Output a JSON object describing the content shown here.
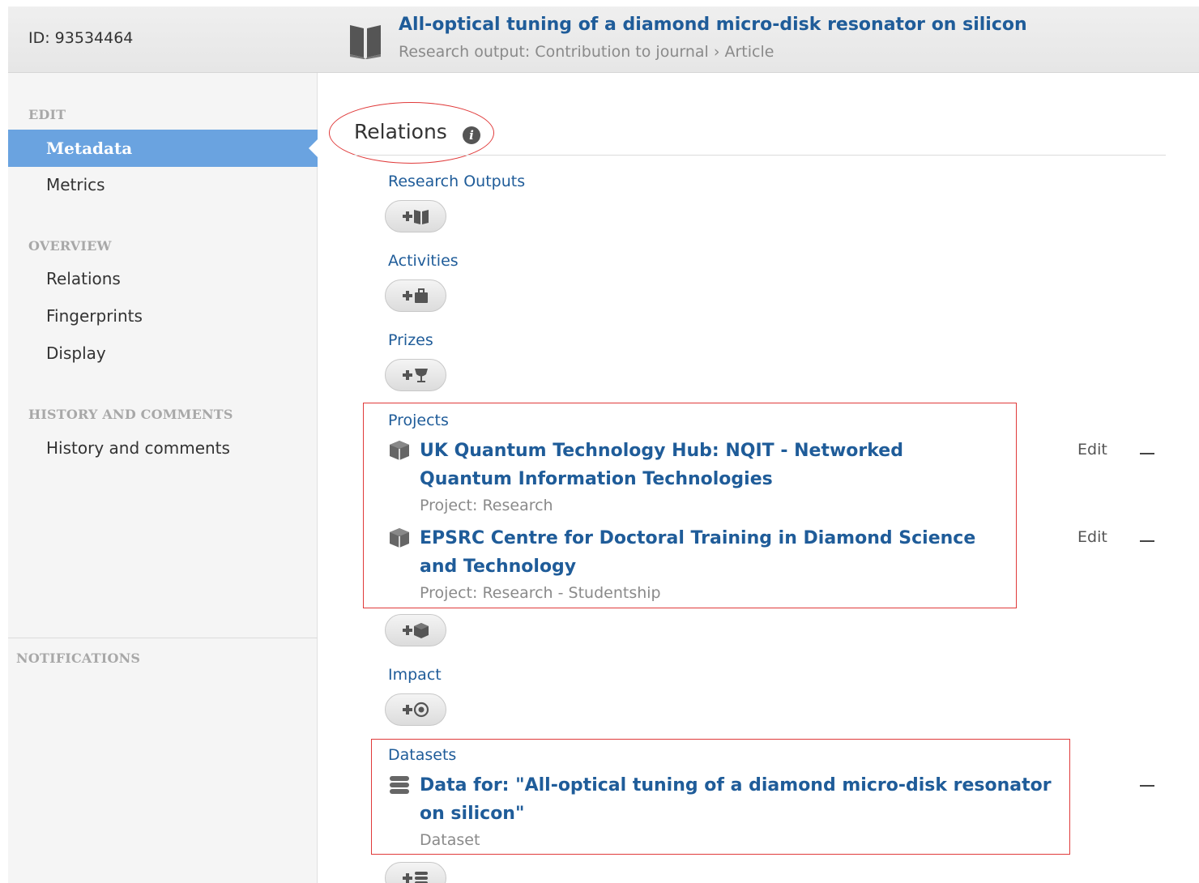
{
  "header": {
    "id_label": "ID: 93534464",
    "title": "All-optical tuning of a diamond micro-disk resonator on silicon",
    "subtitle": "Research output: Contribution to journal › Article",
    "icon": "book-icon"
  },
  "sidebar": {
    "sections": {
      "edit": "EDIT",
      "overview": "OVERVIEW",
      "history": "HISTORY AND COMMENTS",
      "notifications": "NOTIFICATIONS"
    },
    "items": {
      "metadata": "Metadata",
      "metrics": "Metrics",
      "relations": "Relations",
      "fingerprints": "Fingerprints",
      "display": "Display",
      "history_comments": "History and comments"
    },
    "active_item": "Metadata"
  },
  "main": {
    "heading": "Relations",
    "info_icon": "i",
    "sections": {
      "research_outputs": {
        "label": "Research Outputs",
        "add_icon": "add-research-output-icon"
      },
      "activities": {
        "label": "Activities",
        "add_icon": "add-activity-icon"
      },
      "prizes": {
        "label": "Prizes",
        "add_icon": "add-prize-icon"
      },
      "projects": {
        "label": "Projects",
        "add_icon": "add-project-icon",
        "items": [
          {
            "title": "UK Quantum Technology Hub: NQIT - Networked Quantum Information Technologies",
            "subtitle": "Project: Research",
            "edit": "Edit"
          },
          {
            "title": "EPSRC Centre for Doctoral Training in Diamond Science and Technology",
            "subtitle": "Project: Research - Studentship",
            "edit": "Edit"
          }
        ]
      },
      "impact": {
        "label": "Impact",
        "add_icon": "add-impact-icon"
      },
      "datasets": {
        "label": "Datasets",
        "add_icon": "add-dataset-icon",
        "items": [
          {
            "title": "Data for: \"All-optical tuning of a diamond micro-disk resonator on silicon\"",
            "subtitle": "Dataset"
          }
        ]
      }
    }
  },
  "colors": {
    "link_blue": "#1f5c99",
    "active_blue": "#6aa3e0",
    "annotation_red": "#e03a3a"
  }
}
